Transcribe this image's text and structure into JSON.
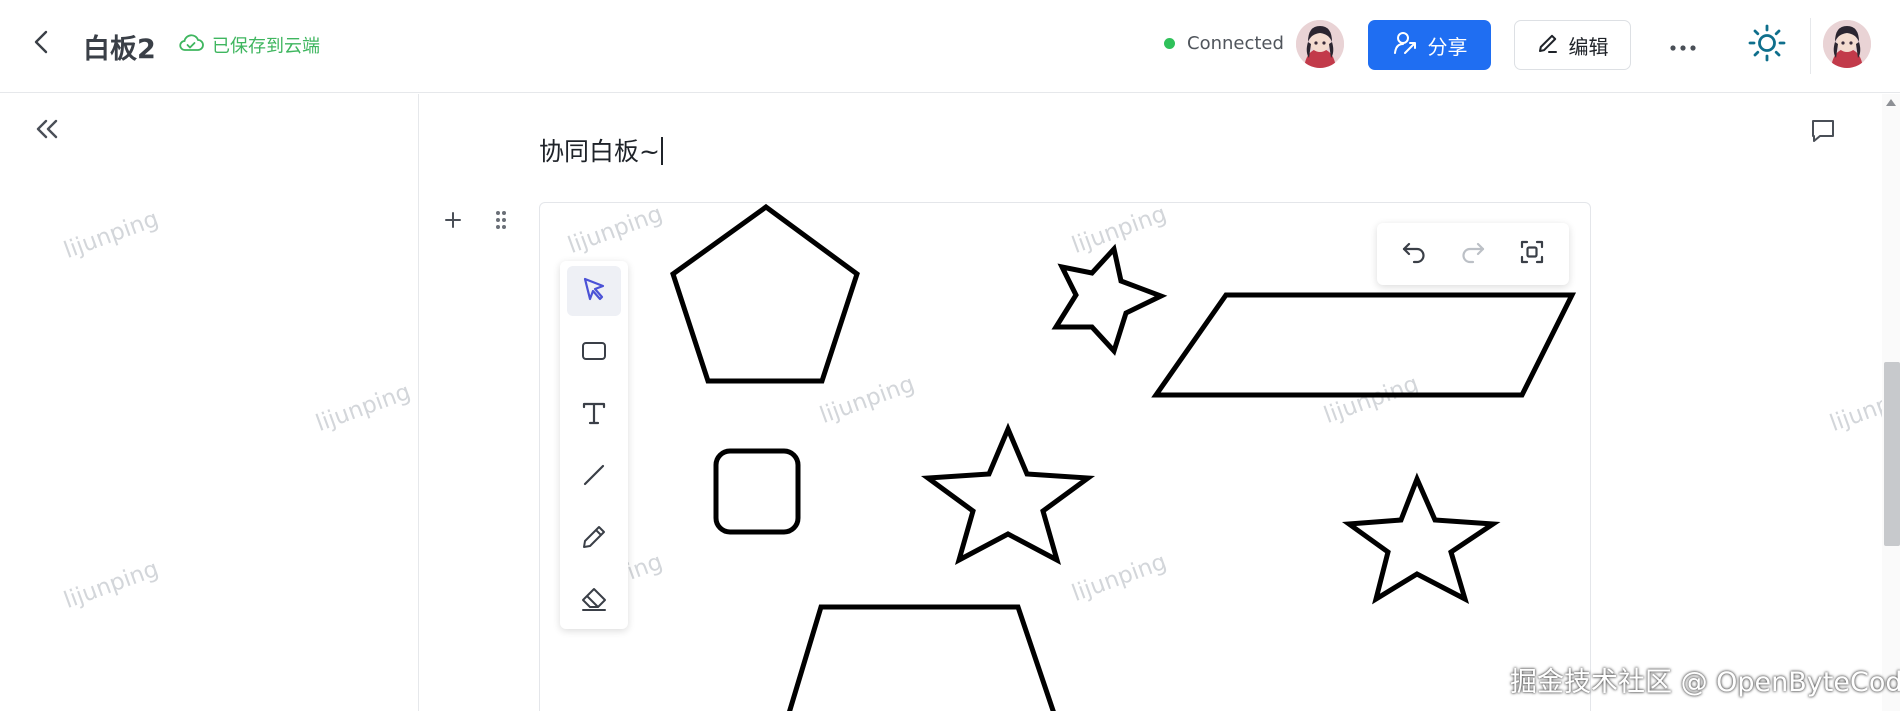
{
  "header": {
    "title": "白板2",
    "save_status": "已保存到云端",
    "connection": "Connected",
    "share_label": "分享",
    "edit_label": "编辑"
  },
  "editor": {
    "heading": "协同白板~"
  },
  "whiteboard": {
    "tools": [
      "select",
      "rectangle",
      "text",
      "line",
      "pencil",
      "eraser"
    ],
    "active_tool": "select",
    "shapes": [
      "pentagon",
      "star",
      "parallelogram",
      "rounded-square",
      "star",
      "star",
      "trapezoid"
    ]
  },
  "watermark": "lijunping",
  "footer_watermark": "掘金技术社区 @ OpenByteCode",
  "colors": {
    "accent": "#1f6ef2",
    "connected": "#2fc15a",
    "saved": "#3fb65f",
    "active_tool": "#4b52d6"
  }
}
